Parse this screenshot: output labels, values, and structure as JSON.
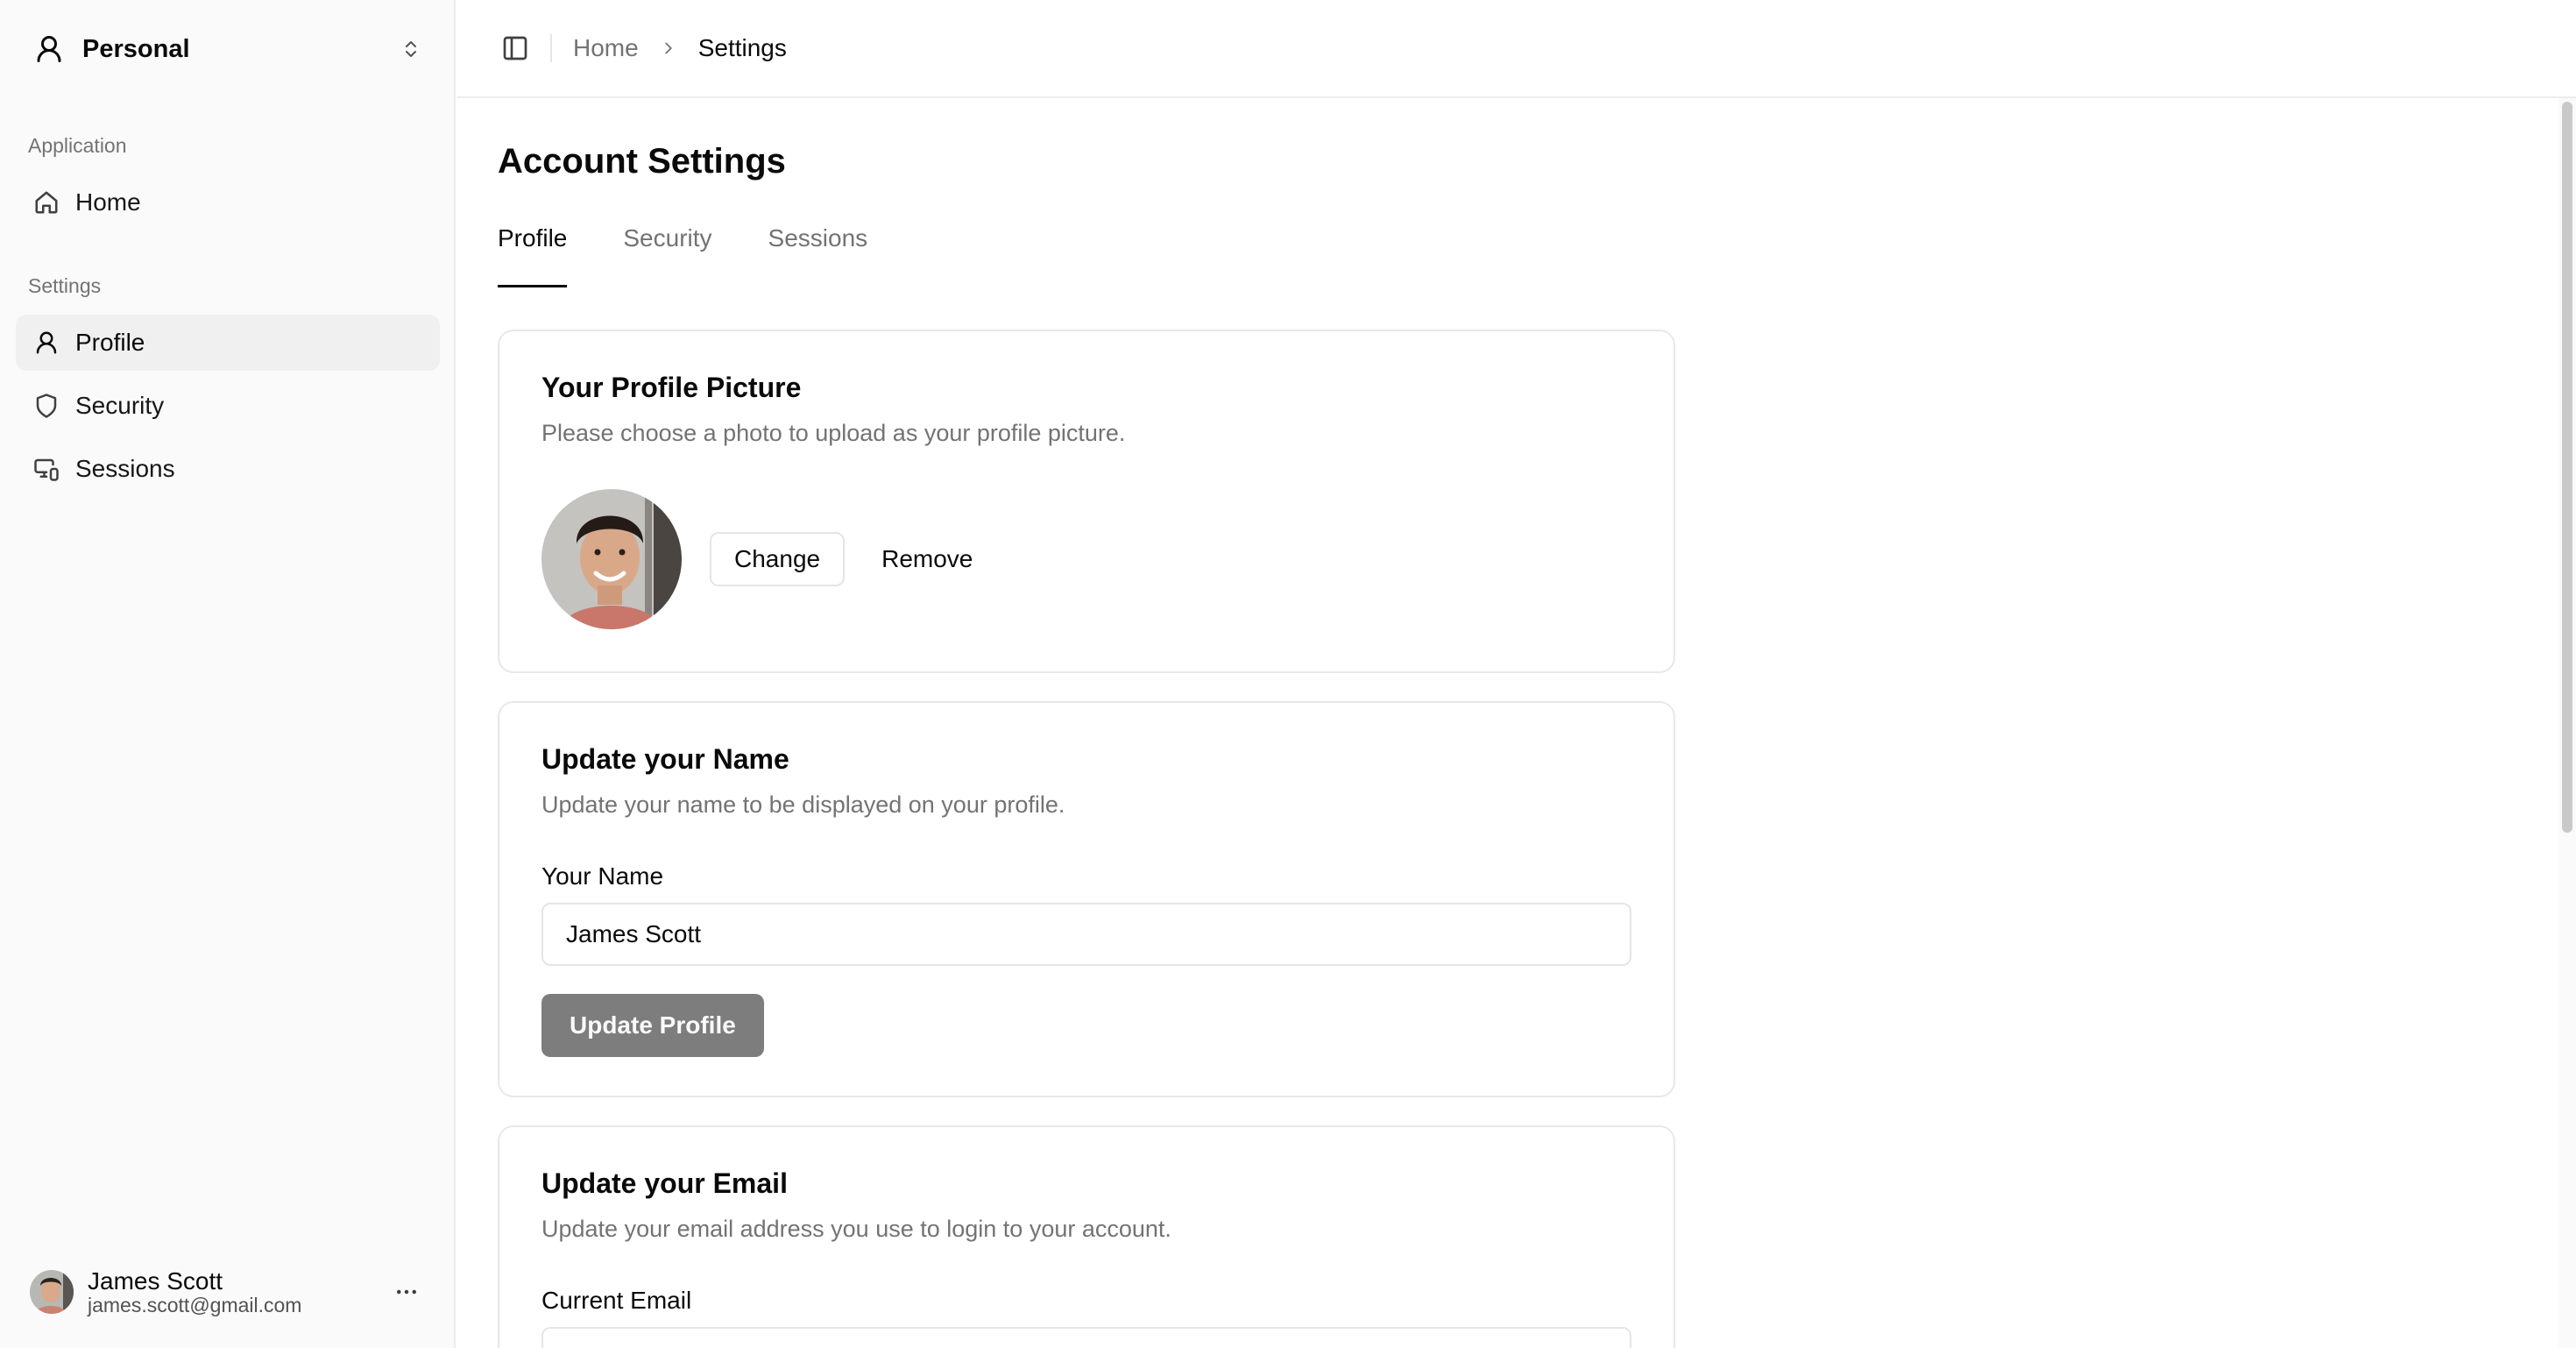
{
  "sidebar": {
    "workspace": {
      "label": "Personal",
      "icon": "user-icon"
    },
    "groups": [
      {
        "label": "Application",
        "items": [
          {
            "label": "Home",
            "icon": "home-icon"
          }
        ]
      },
      {
        "label": "Settings",
        "items": [
          {
            "label": "Profile",
            "icon": "user-icon",
            "active": true
          },
          {
            "label": "Security",
            "icon": "shield-icon"
          },
          {
            "label": "Sessions",
            "icon": "monitor-smartphone-icon"
          }
        ]
      }
    ],
    "user": {
      "name": "James Scott",
      "email": "james.scott@gmail.com"
    }
  },
  "header": {
    "breadcrumb": [
      "Home",
      "Settings"
    ]
  },
  "main": {
    "title": "Account Settings",
    "tabs": [
      {
        "label": "Profile",
        "active": true
      },
      {
        "label": "Security"
      },
      {
        "label": "Sessions"
      }
    ],
    "profile_picture": {
      "title": "Your Profile Picture",
      "description": "Please choose a photo to upload as your profile picture.",
      "change_label": "Change",
      "remove_label": "Remove"
    },
    "update_name": {
      "title": "Update your Name",
      "description": "Update your name to be displayed on your profile.",
      "field_label": "Your Name",
      "value": "James Scott",
      "button_label": "Update Profile"
    },
    "update_email": {
      "title": "Update your Email",
      "description": "Update your email address you use to login to your account.",
      "field_label": "Current Email"
    }
  },
  "colors": {
    "accent": "#0a0a0a",
    "muted_text": "#737373",
    "sidebar_bg": "#fafafa",
    "disabled_button": "#7d7d7d"
  }
}
